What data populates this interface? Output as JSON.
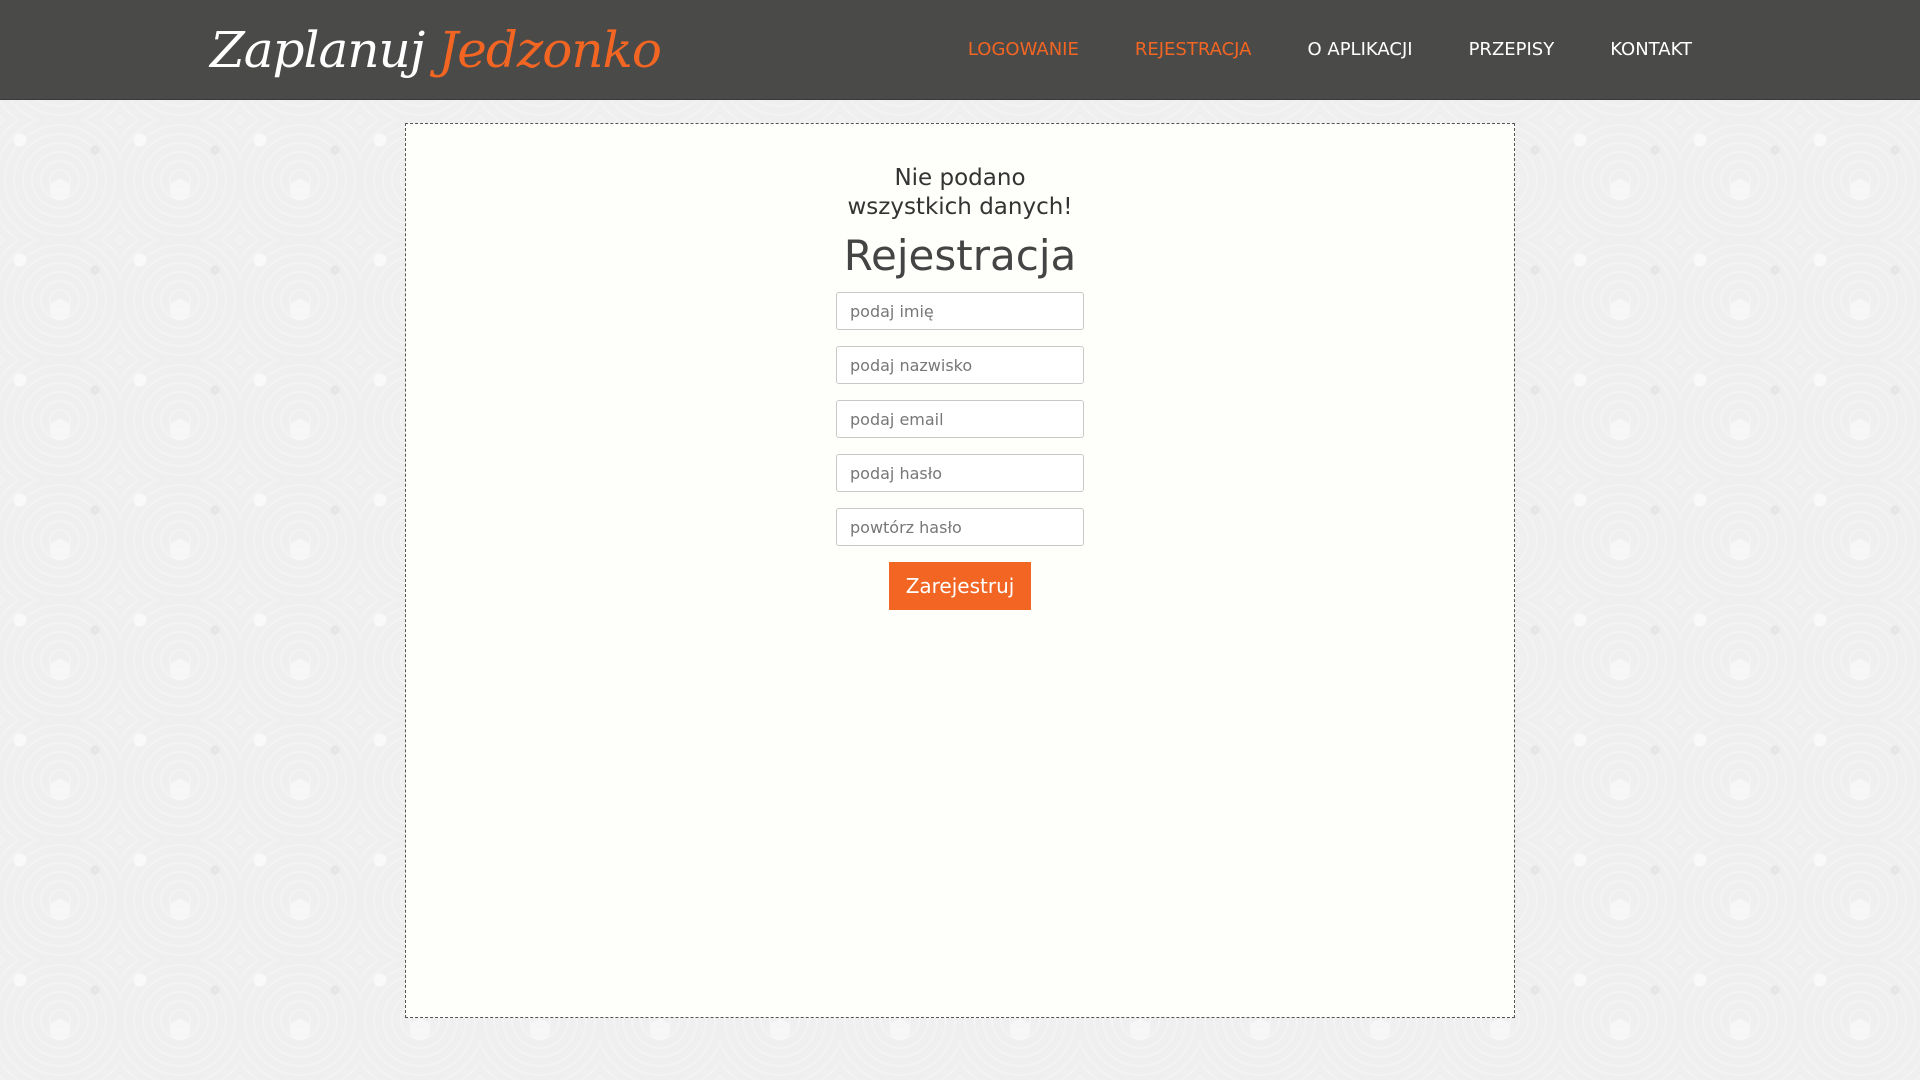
{
  "header": {
    "logo_part1": "Zaplanuj",
    "logo_part2": "Jedzonko",
    "nav": [
      {
        "label": "LOGOWANIE",
        "active": true
      },
      {
        "label": "REJESTRACJA",
        "active": true
      },
      {
        "label": "O APLIKACJI",
        "active": false
      },
      {
        "label": "PRZEPISY",
        "active": false
      },
      {
        "label": "KONTAKT",
        "active": false
      }
    ]
  },
  "main": {
    "error_line1": "Nie podano",
    "error_line2": "wszystkich danych!",
    "title": "Rejestracja",
    "fields": [
      {
        "placeholder": "podaj imię",
        "value": ""
      },
      {
        "placeholder": "podaj nazwisko",
        "value": ""
      },
      {
        "placeholder": "podaj email",
        "value": ""
      },
      {
        "placeholder": "podaj hasło",
        "value": ""
      },
      {
        "placeholder": "powtórz hasło",
        "value": ""
      }
    ],
    "submit_label": "Zarejestruj"
  },
  "colors": {
    "accent": "#f26522",
    "header_bg": "#4a4a49",
    "panel_bg": "#fefefa"
  }
}
